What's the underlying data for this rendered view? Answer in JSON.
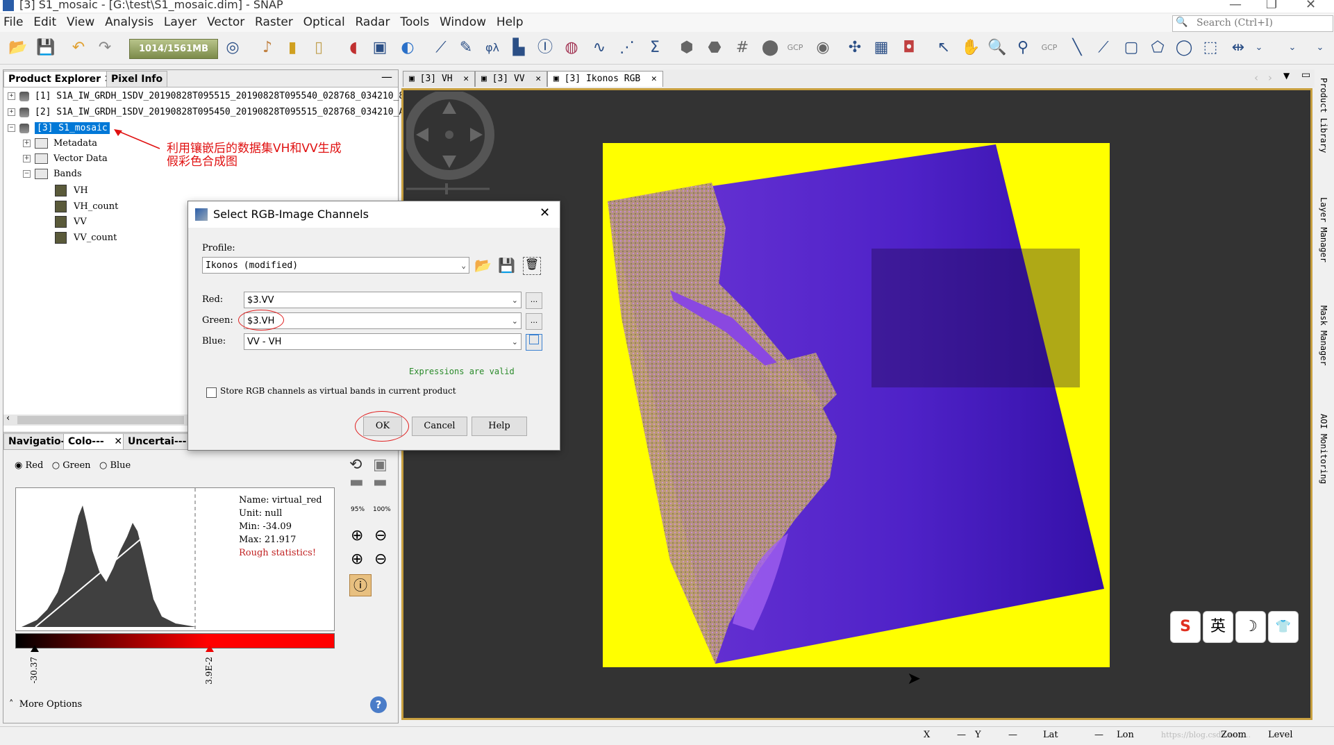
{
  "window": {
    "title": "[3] S1_mosaic - [G:\\test\\S1_mosaic.dim] - SNAP"
  },
  "menu": [
    "File",
    "Edit",
    "View",
    "Analysis",
    "Layer",
    "Vector",
    "Raster",
    "Optical",
    "Radar",
    "Tools",
    "Window",
    "Help"
  ],
  "search": {
    "placeholder": "Search (Ctrl+I)"
  },
  "toolbar": {
    "memory": "1014/1561MB",
    "gcp1": "GCP",
    "gcp2": "GCP"
  },
  "left_tabs": {
    "product_explorer": "Product Explorer",
    "pixel_info": "Pixel Info"
  },
  "tree": {
    "p1": "[1] S1A_IW_GRDH_1SDV_20190828T095515_20190828T095540_028768_034210_8",
    "p2": "[2] S1A_IW_GRDH_1SDV_20190828T095450_20190828T095515_028768_034210_A",
    "p3": "[3] S1_mosaic",
    "metadata": "Metadata",
    "vector": "Vector Data",
    "bands": "Bands",
    "b1": "VH",
    "b2": "VH_count",
    "b3": "VV",
    "b4": "VV_count"
  },
  "annotation": {
    "line1": "利用镶嵌后的数据集VH和VV生成",
    "line2": "假彩色合成图"
  },
  "lower_tabs": {
    "nav": "Navigatio---",
    "color": "Colo---",
    "unc": "Uncertai---"
  },
  "channels": {
    "red": "Red",
    "green": "Green",
    "blue": "Blue"
  },
  "stats": {
    "name": "Name: virtual_red",
    "unit": "Unit: null",
    "min": "Min: -34.09",
    "max": "Max: 21.917",
    "rough": "Rough statistics!"
  },
  "slider": {
    "low": "-30.37",
    "high": "3.9E-2",
    "pct1": "95%",
    "pct2": "100%"
  },
  "more_options": "More Options",
  "image_tabs": [
    "[3] VH",
    "[3] VV",
    "[3] Ikonos RGB"
  ],
  "side_labels": [
    "Product Library",
    "Layer Manager",
    "Mask Manager",
    "AOI Monitoring"
  ],
  "dialog": {
    "title": "Select RGB-Image Channels",
    "profile_label": "Profile:",
    "profile_value": "Ikonos (modified)",
    "red_label": "Red:",
    "red_value": "$3.VV",
    "green_label": "Green:",
    "green_value": "$3.VH",
    "blue_label": "Blue:",
    "blue_value": "VV - VH",
    "valid": "Expressions are valid",
    "store": "Store RGB channels as virtual bands in current product",
    "ok": "OK",
    "cancel": "Cancel",
    "help": "Help",
    "ellipsis": "..."
  },
  "statusbar": {
    "x": "X",
    "y": "Y",
    "lat": "Lat",
    "lon": "Lon",
    "zoom": "Zoom",
    "level": "Level",
    "dash": "—",
    "watermark": "https://blog.csdn.net/..."
  },
  "ime": [
    "S",
    "英",
    "☽",
    "👕"
  ],
  "colors": {
    "accent": "#0078d7",
    "overlay_yellow": "#ffff00",
    "annotation_red": "#e01010"
  }
}
